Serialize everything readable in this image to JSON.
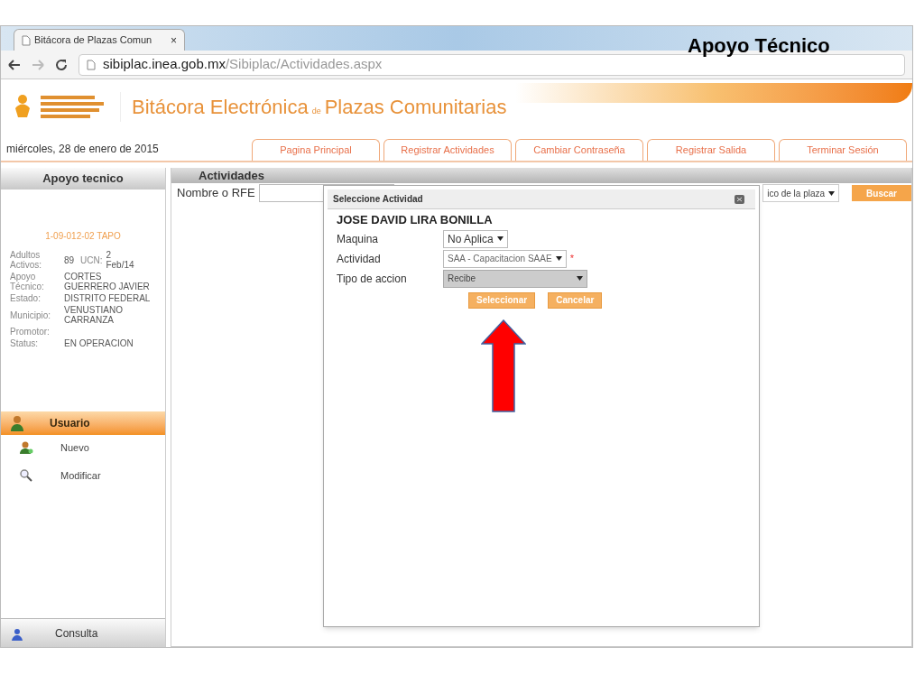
{
  "slide_title": "Apoyo Técnico",
  "browser": {
    "tab_title": "Bitácora de Plazas Comun",
    "tab_close": "×",
    "url_host": "sibiplac.inea.gob.mx",
    "url_path": "/Sibiplac/Actividades.aspx"
  },
  "header": {
    "title_main": "Bitácora Electrónica",
    "title_connector": "de",
    "title_rest": "Plazas Comunitarias"
  },
  "date": "miércoles, 28 de enero de 2015",
  "nav_tabs": [
    "Pagina Principal",
    "Registrar Actividades",
    "Cambiar Contraseña",
    "Registrar Salida",
    "Terminar Sesión"
  ],
  "sidebar": {
    "title": "Apoyo tecnico",
    "plaza_code": "1-09-012-02 TAPO",
    "adults": {
      "label": "Adultos Activos:",
      "value": "89",
      "ucn_label": "UCN:",
      "ucn_value": "2 Feb/14"
    },
    "info": [
      {
        "label": "Apoyo Técnico:",
        "value": "CORTES GUERRERO JAVIER"
      },
      {
        "label": "Estado:",
        "value": "DISTRITO FEDERAL"
      },
      {
        "label": "Municipio:",
        "value": "VENUSTIANO CARRANZA"
      },
      {
        "label": "Promotor:"
      },
      {
        "label": "Status:",
        "value": "EN OPERACION"
      }
    ],
    "menu_header": "Usuario",
    "menu_items": [
      {
        "label": "Nuevo",
        "kind": "user"
      },
      {
        "label": "Modificar",
        "kind": "search"
      }
    ],
    "footer": "Consulta"
  },
  "main": {
    "title": "Actividades",
    "search_label": "Nombre o RFE",
    "filter_value": "ico de la plaza",
    "search_button": "Buscar"
  },
  "dialog": {
    "title": "Seleccione Actividad",
    "person": "JOSE DAVID LIRA BONILLA",
    "fields": [
      {
        "label": "Maquina",
        "value": "No Aplica",
        "disabled": false,
        "required": false
      },
      {
        "label": "Actividad",
        "value": "SAA - Capacitacion SAAE",
        "disabled": false,
        "required": true
      },
      {
        "label": "Tipo de accion",
        "value": "Recibe",
        "disabled": true,
        "required": false
      }
    ],
    "required_mark": "*",
    "buttons": [
      "Seleccionar",
      "Cancelar"
    ]
  }
}
